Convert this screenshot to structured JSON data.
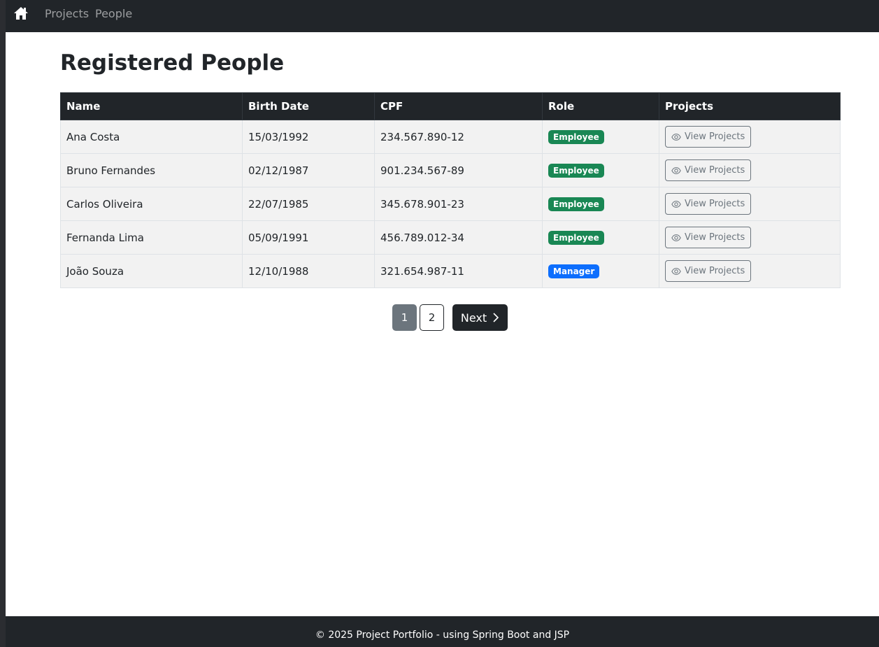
{
  "navbar": {
    "home_icon": "home-icon",
    "links": [
      {
        "label": "Projects"
      },
      {
        "label": "People"
      }
    ]
  },
  "page": {
    "title": "Registered People"
  },
  "table": {
    "columns": [
      "Name",
      "Birth Date",
      "CPF",
      "Role",
      "Projects"
    ],
    "rows": [
      {
        "name": "Ana Costa",
        "birth_date": "15/03/1992",
        "cpf": "234.567.890-12",
        "role": "Employee",
        "action": "View Projects"
      },
      {
        "name": "Bruno Fernandes",
        "birth_date": "02/12/1987",
        "cpf": "901.234.567-89",
        "role": "Employee",
        "action": "View Projects"
      },
      {
        "name": "Carlos Oliveira",
        "birth_date": "22/07/1985",
        "cpf": "345.678.901-23",
        "role": "Employee",
        "action": "View Projects"
      },
      {
        "name": "Fernanda Lima",
        "birth_date": "05/09/1991",
        "cpf": "456.789.012-34",
        "role": "Employee",
        "action": "View Projects"
      },
      {
        "name": "João Souza",
        "birth_date": "12/10/1988",
        "cpf": "321.654.987-11",
        "role": "Manager",
        "action": "View Projects"
      }
    ]
  },
  "pagination": {
    "pages": [
      "1",
      "2"
    ],
    "current": "1",
    "next_label": "Next"
  },
  "footer": {
    "text": "© 2025 Project Portfolio - using Spring Boot and JSP"
  },
  "colors": {
    "navbar": "#212529",
    "employee_badge": "#198754",
    "manager_badge": "#0d6efd",
    "active_page": "#6c757d"
  }
}
